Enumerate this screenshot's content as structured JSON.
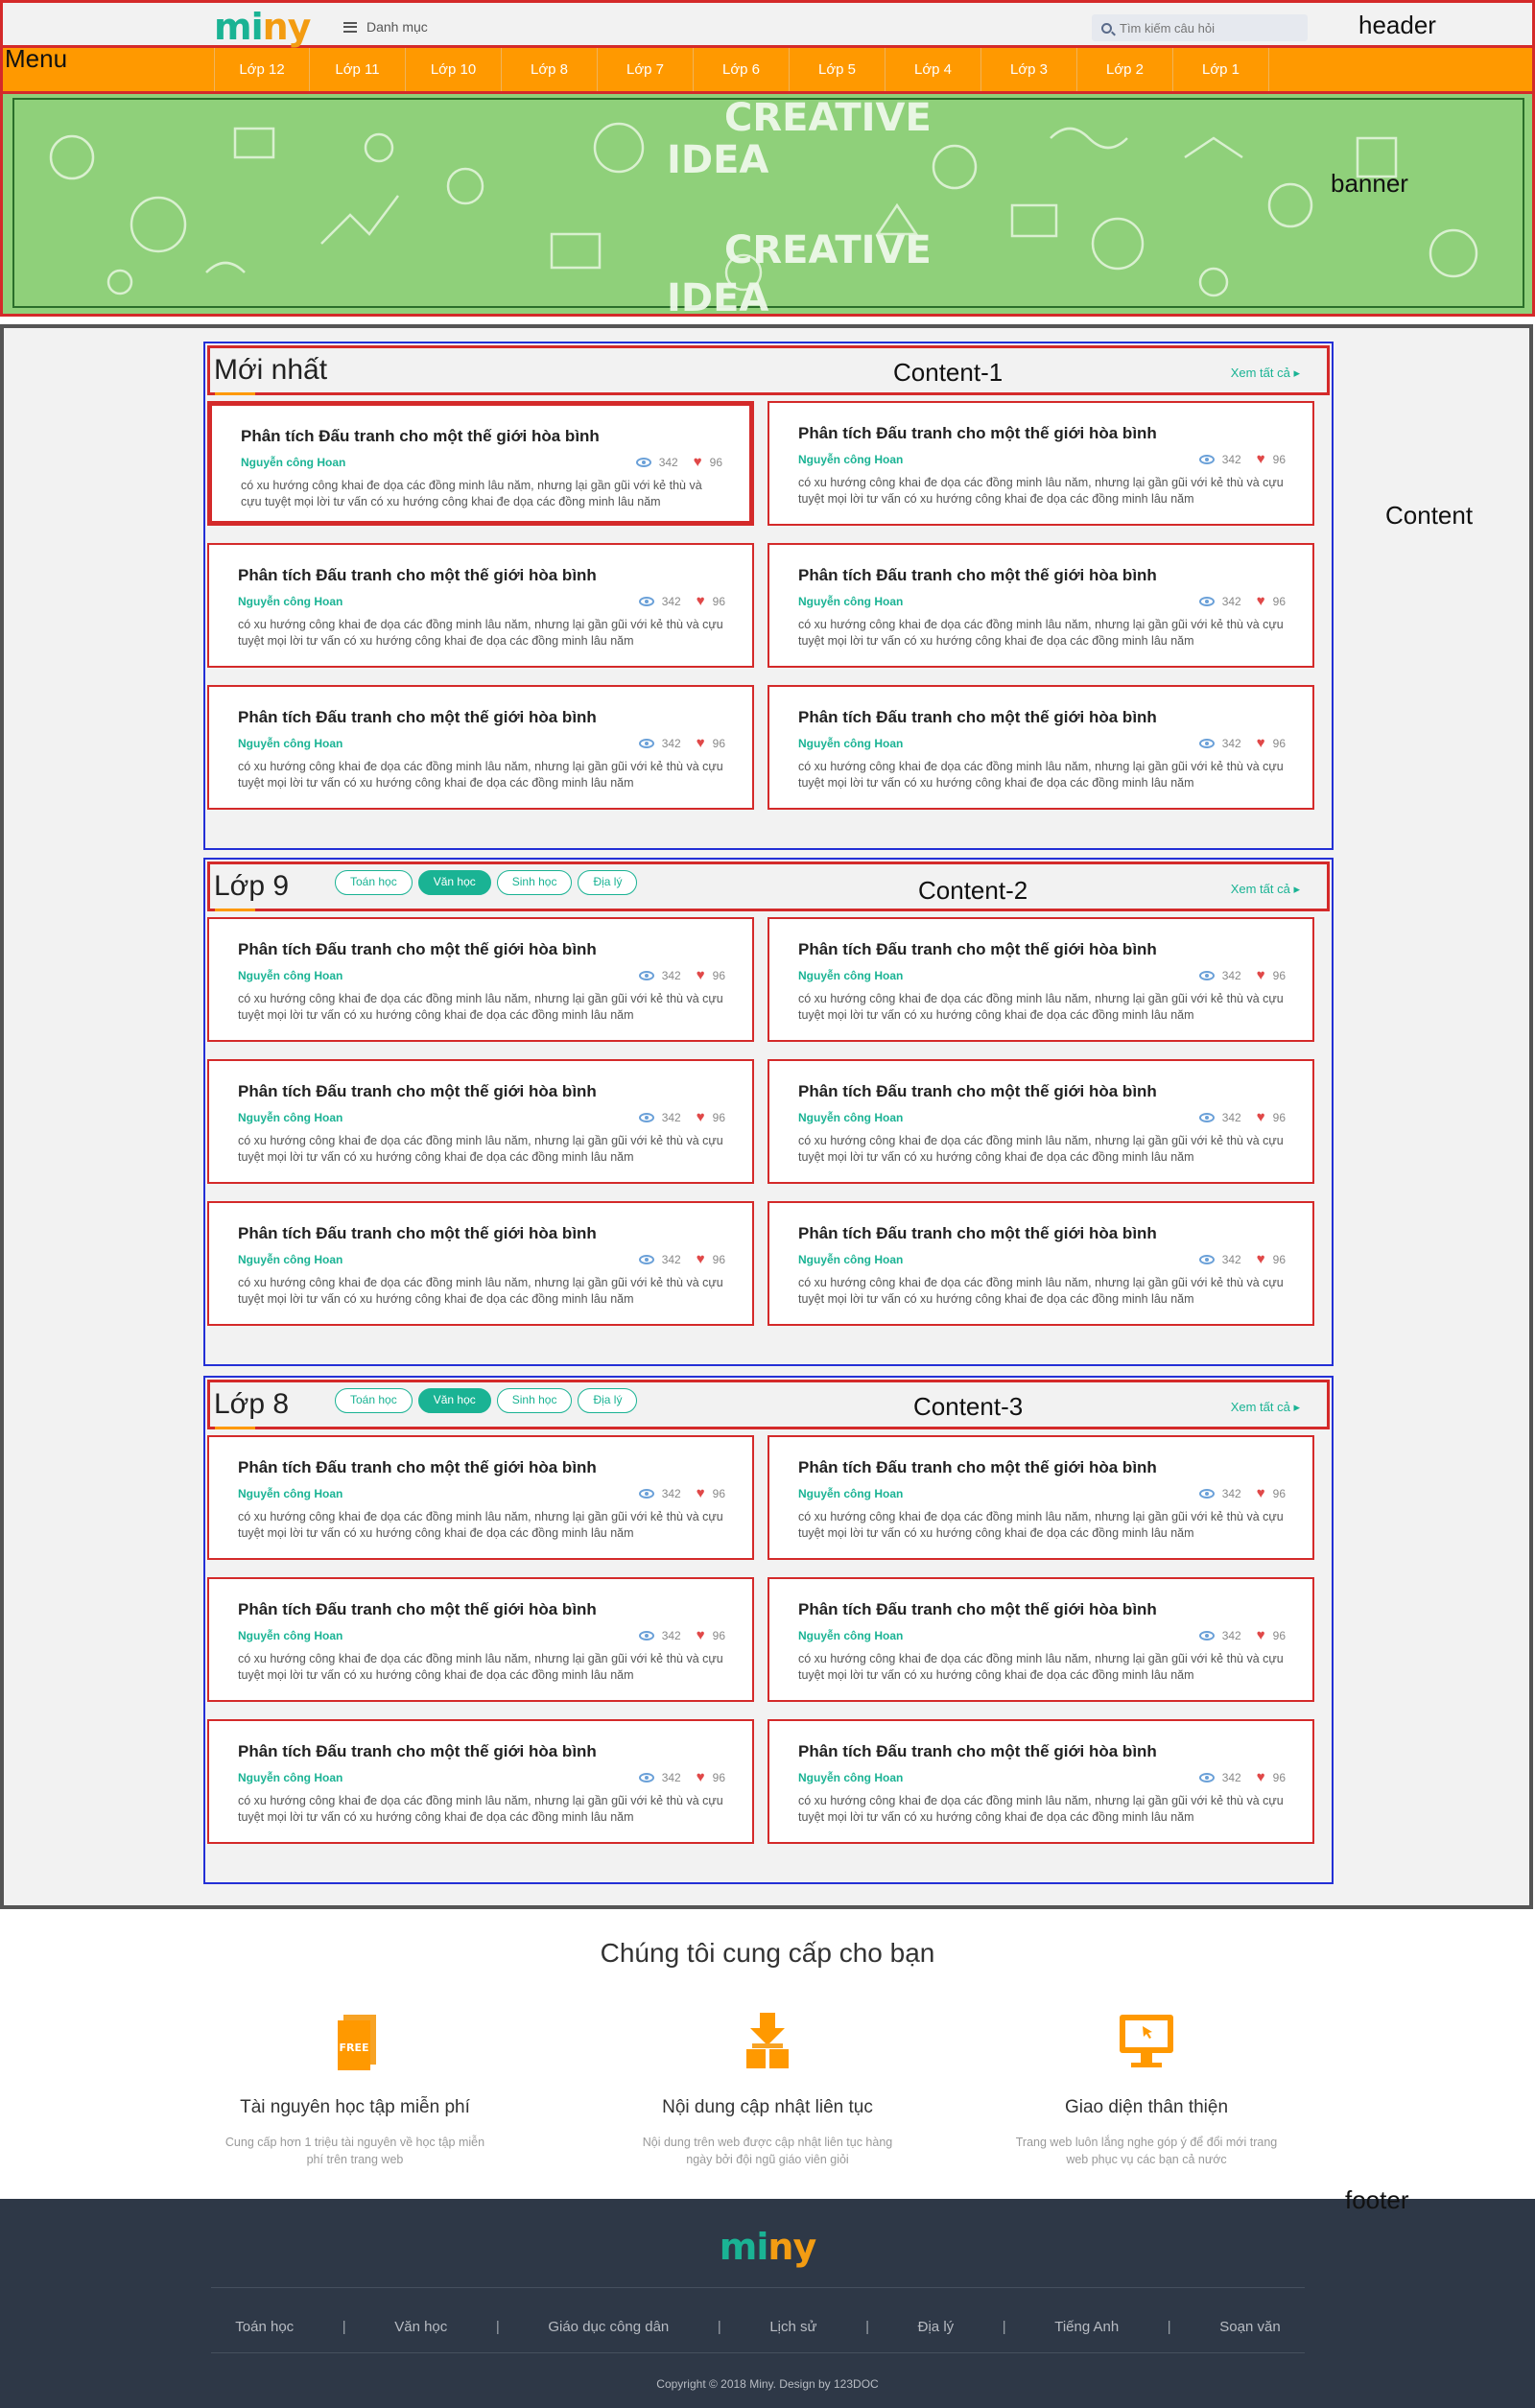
{
  "header": {
    "logo_left": "mi",
    "logo_right": "ny",
    "category_label": "Danh mục",
    "search_placeholder": "Tìm kiếm câu hỏi",
    "annotation": "header"
  },
  "menu": {
    "annotation": "Menu",
    "items": [
      "Lớp 12",
      "Lớp 11",
      "Lớp 10",
      "Lớp 8",
      "Lớp 7",
      "Lớp 6",
      "Lớp 5",
      "Lớp 4",
      "Lớp 3",
      "Lớp 2",
      "Lớp 1"
    ]
  },
  "banner": {
    "annotation": "banner",
    "words": [
      "CREATIVE",
      "IDEA",
      "CREATIVE",
      "IDEA"
    ]
  },
  "content": {
    "annotation": "Content",
    "see_all": "Xem tất cả ▸",
    "card": {
      "title": "Phân tích Đấu tranh cho một thế giới hòa bình",
      "author": "Nguyễn công Hoan",
      "views": "342",
      "likes": "96",
      "desc": "có xu hướng công khai đe dọa các đồng minh lâu năm, nhưng lại gần gũi với kẻ thù và cựu tuyệt mọi lời tư vấn có xu hướng công khai đe dọa các đồng minh lâu năm"
    },
    "sections": [
      {
        "title": "Mới nhất",
        "annotation": "Content-1",
        "tags": []
      },
      {
        "title": "Lớp 9",
        "annotation": "Content-2",
        "tags": [
          "Toán học",
          "Văn học",
          "Sinh học",
          "Địa lý"
        ],
        "active_tag": "Văn học"
      },
      {
        "title": "Lớp 8",
        "annotation": "Content-3",
        "tags": [
          "Toán học",
          "Văn học",
          "Sinh học",
          "Địa lý"
        ],
        "active_tag": "Văn học"
      }
    ]
  },
  "provide": {
    "title": "Chúng tôi cung cấp cho bạn",
    "features": [
      {
        "icon": "free-file-icon",
        "badge": "FREE",
        "title": "Tài nguyên học tập miễn phí",
        "desc": "Cung cấp hơn 1 triệu tài nguyên về học tập miễn phí trên trang web"
      },
      {
        "icon": "download-box-icon",
        "title": "Nội dung cập nhật liên tục",
        "desc": "Nội dung trên web được cập nhật liên tục hàng ngày bởi đội ngũ giáo viên giỏi"
      },
      {
        "icon": "monitor-icon",
        "title": "Giao diện thân thiện",
        "desc": "Trang web luôn lắng nghe góp ý để đổi mới trang web phục vụ các bạn cả nước"
      }
    ]
  },
  "footer": {
    "annotation": "footer",
    "links": [
      "Toán học",
      "Văn học",
      "Giáo dục công dân",
      "Lịch sử",
      "Địa lý",
      "Tiếng Anh",
      "Soạn văn"
    ],
    "separator": "|",
    "copyright": "Copyright © 2018 Miny. Design by 123DOC"
  },
  "colors": {
    "brand_teal": "#1ab394",
    "brand_orange": "#ff9900",
    "annotation_red": "#d42a2a",
    "annotation_blue": "#2430d6",
    "footer_bg": "#2e3847"
  }
}
